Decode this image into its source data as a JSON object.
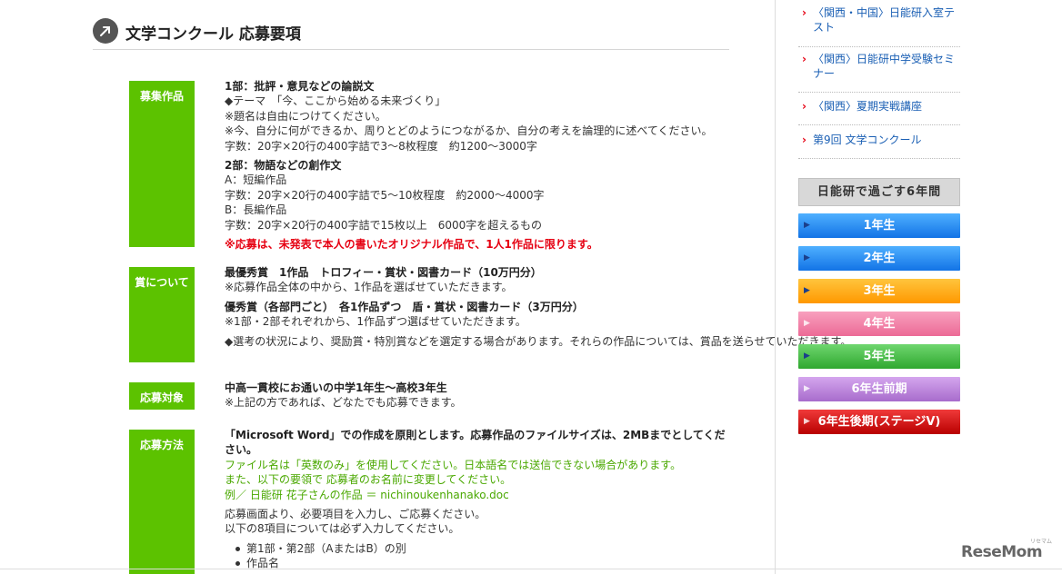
{
  "page": {
    "title": "文学コンクール 応募要項"
  },
  "sections": {
    "works": {
      "label": "募集作品",
      "part1_title": "1部：批評・意見などの論説文",
      "part1_theme": "◆テーマ　「今、ここから始める未来づくり」",
      "part1_note1": "※題名は自由につけてください。",
      "part1_note2": "※今、自分に何ができるか、周りとどのようにつながるか、自分の考えを論理的に述べてください。",
      "part1_count": "字数：20字×20行の400字詰で3〜8枚程度　約1200〜3000字",
      "part2_title": "2部：物語などの創作文",
      "part2_a": "A：短編作品",
      "part2_a_count": "字数：20字×20行の400字詰で5〜10枚程度　約2000〜4000字",
      "part2_b": "B：長編作品",
      "part2_b_count": "字数：20字×20行の400字詰で15枚以上　6000字を超えるもの",
      "notice": "※応募は、未発表で本人の書いたオリジナル作品で、1人1作品に限ります。"
    },
    "prizes": {
      "label": "賞について",
      "grand_title": "最優秀賞　1作品　トロフィー・賞状・図書カード（10万円分）",
      "grand_note": "※応募作品全体の中から、1作品を選ばせていただきます。",
      "excellent_title": "優秀賞（各部門ごと）　各1作品ずつ　盾・賞状・図書カード（3万円分）",
      "excellent_note": "※1部・2部それぞれから、1作品ずつ選ばせていただきます。",
      "extra_note": "◆選考の状況により、奨励賞・特別賞などを選定する場合があります。それらの作品については、賞品を送らせていただきます。"
    },
    "eligibility": {
      "label": "応募対象",
      "target": "中高一貫校にお通いの中学1年生〜高校3年生",
      "note": "※上記の方であれば、どなたでも応募できます。"
    },
    "method": {
      "label": "応募方法",
      "word_rule": "「Microsoft Word」での作成を原則とします。応募作品のファイルサイズは、2MBまでとしてください。",
      "filename_rule": "ファイル名は「英数のみ」を使用してください。日本語名では送信できない場合があります。",
      "rename_rule": "また、以下の要領で 応募者のお名前に変更してください。",
      "example": "例／ 日能研 花子さんの作品 ＝ nichinoukenhanako.doc",
      "input_note": "応募画面より、必要項目を入力し、ご応募ください。",
      "required_note": "以下の8項目については必ず入力してください。",
      "items": [
        "第1部・第2部（AまたはB）の別",
        "作品名"
      ]
    }
  },
  "sidebar": {
    "links": [
      "〈関西・中国〉日能研入室テスト",
      "〈関西〉日能研中学受験セミナー",
      "〈関西〉夏期実戦講座",
      "第9回 文学コンクール"
    ],
    "grade_heading": "日能研で過ごす6年間",
    "grades": [
      {
        "label": "1年生",
        "color": "#1e8cf0"
      },
      {
        "label": "2年生",
        "color": "#1e8cf0"
      },
      {
        "label": "3年生",
        "color": "#ffa000"
      },
      {
        "label": "4年生",
        "color": "#f06292"
      },
      {
        "label": "5年生",
        "color": "#3cb93c"
      },
      {
        "label": "6年生前期",
        "color": "#b57ad6"
      },
      {
        "label": "6年生後期(ステージV)",
        "color": "#d50000"
      }
    ]
  },
  "footer": {
    "logo": "ReseMom",
    "logo_sup": "リセマム"
  }
}
